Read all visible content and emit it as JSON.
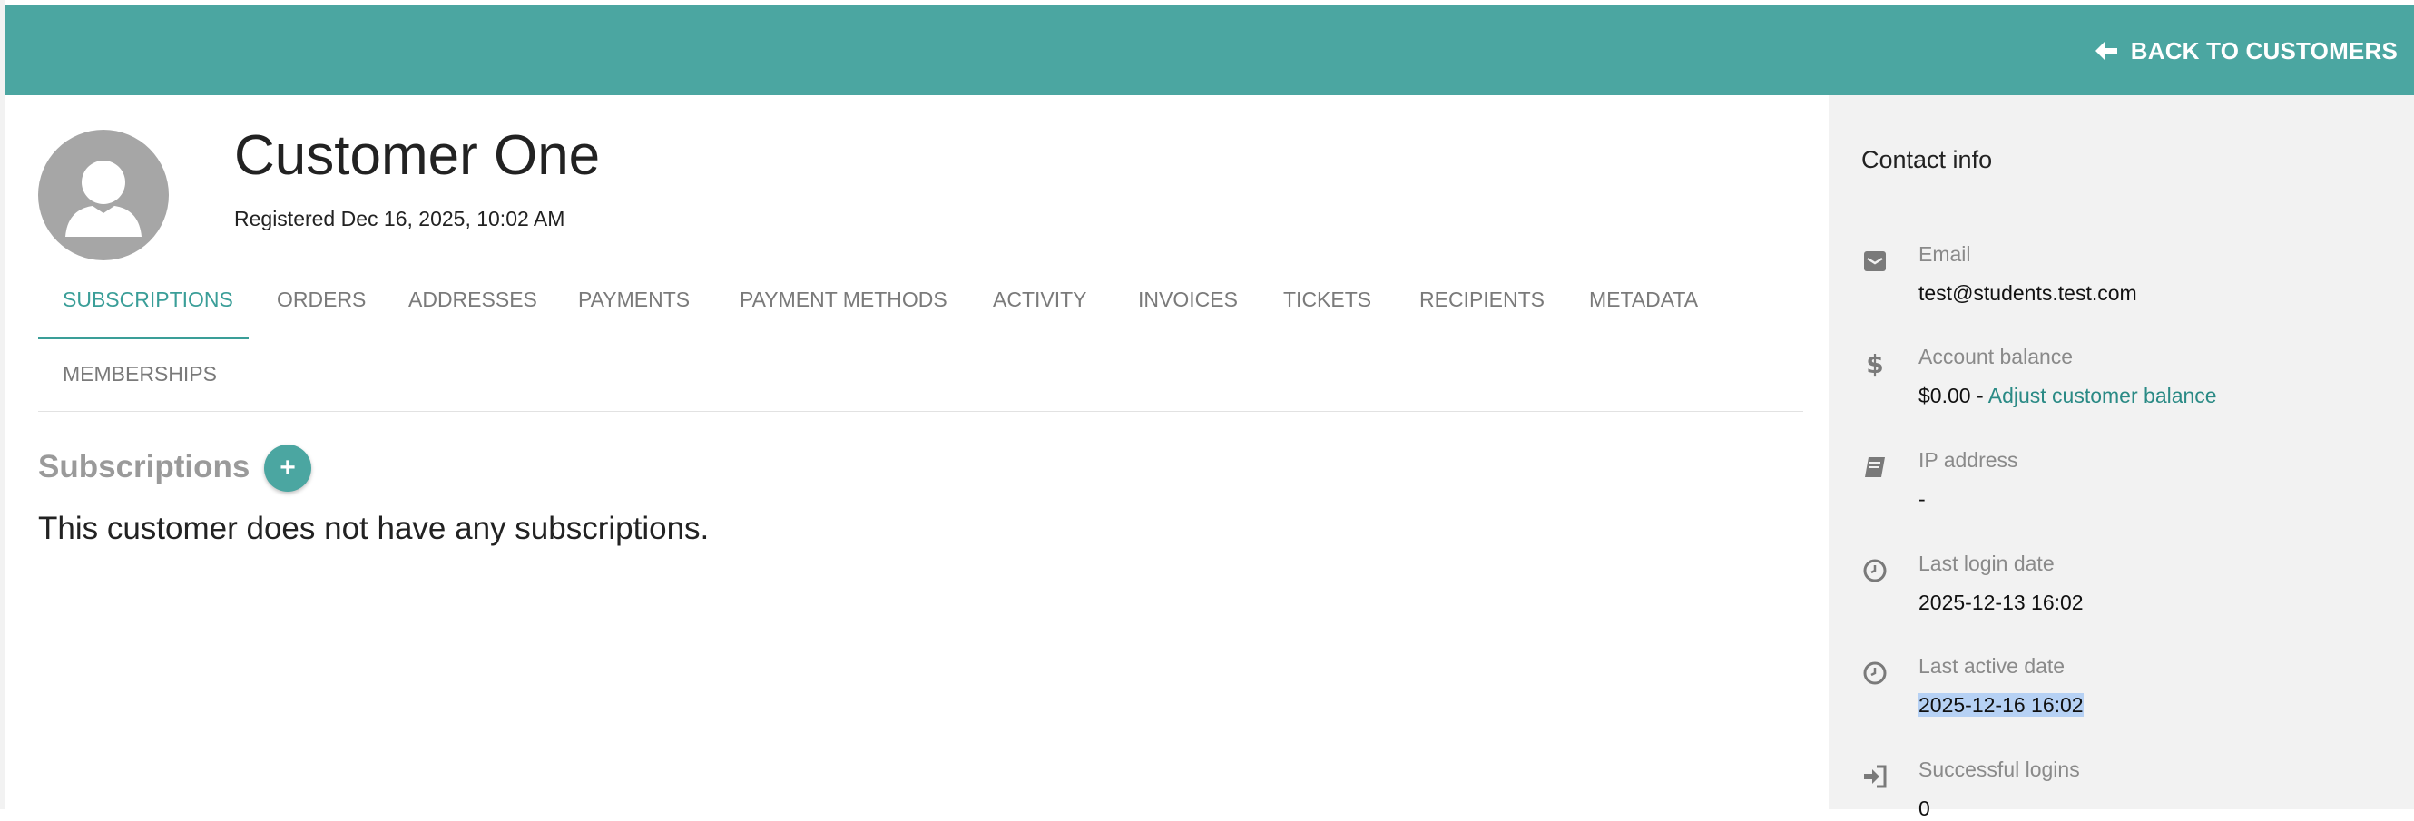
{
  "header": {
    "back_label": "BACK TO CUSTOMERS",
    "accent_color": "#4ba6a1"
  },
  "customer": {
    "name": "Customer One",
    "registered": "Registered Dec 16, 2025, 10:02 AM",
    "avatar_icon": "user-silhouette-icon"
  },
  "tabs": [
    {
      "label": "SUBSCRIPTIONS",
      "active": true
    },
    {
      "label": "ORDERS"
    },
    {
      "label": "ADDRESSES"
    },
    {
      "label": "PAYMENTS"
    },
    {
      "label": "PAYMENT METHODS"
    },
    {
      "label": "ACTIVITY"
    },
    {
      "label": "INVOICES"
    },
    {
      "label": "TICKETS"
    },
    {
      "label": "RECIPIENTS"
    },
    {
      "label": "METADATA"
    },
    {
      "label": "MEMBERSHIPS"
    }
  ],
  "subscriptions": {
    "title": "Subscriptions",
    "add_icon": "plus-icon",
    "empty_message": "This customer does not have any subscriptions."
  },
  "contact": {
    "title": "Contact info",
    "items": [
      {
        "icon": "envelope-icon",
        "label": "Email",
        "value": "test@students.test.com"
      },
      {
        "icon": "dollar-icon",
        "label": "Account balance",
        "value": "$0.00",
        "separator": " - ",
        "link": "Adjust customer balance"
      },
      {
        "icon": "book-icon",
        "label": "IP address",
        "value": "-"
      },
      {
        "icon": "clock-icon",
        "label": "Last login date",
        "value": "2025-12-13 16:02"
      },
      {
        "icon": "clock-icon",
        "label": "Last active date",
        "value": "2025-12-16 16:02",
        "selected": true
      },
      {
        "icon": "sign-in-icon",
        "label": "Successful logins",
        "value": "0"
      }
    ]
  }
}
